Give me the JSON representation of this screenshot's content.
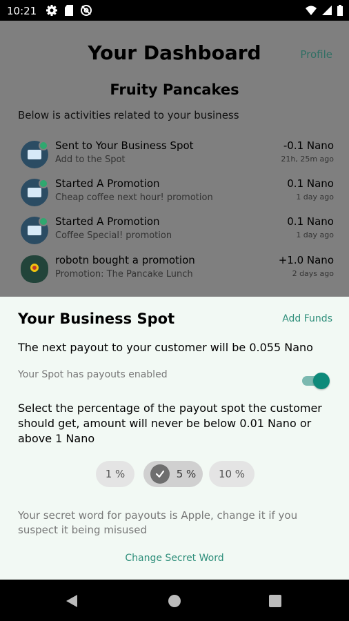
{
  "status_bar": {
    "time": "10:21",
    "icons_left": [
      "gear-icon",
      "sd-card-icon",
      "at-sign-icon"
    ],
    "icons_right": [
      "wifi-icon",
      "signal-icon",
      "battery-icon"
    ]
  },
  "header": {
    "title": "Your Dashboard",
    "profile_link": "Profile",
    "business_name": "Fruity Pancakes",
    "subtitle": "Below is activities related to your business"
  },
  "activities": [
    {
      "title": "Sent to Your Business Spot",
      "description": "Add to the Spot",
      "amount": "-0.1 Nano",
      "time": "21h, 25m ago",
      "avatar": "shop-icon"
    },
    {
      "title": "Started A Promotion",
      "description": "Cheap coffee next hour! promotion",
      "amount": "0.1 Nano",
      "time": "1 day ago",
      "avatar": "shop-icon"
    },
    {
      "title": "Started A Promotion",
      "description": "Coffee Special! promotion",
      "amount": "0.1 Nano",
      "time": "1 day ago",
      "avatar": "shop-icon"
    },
    {
      "title": "robotn bought a promotion",
      "description": "Promotion: The Pancake Lunch",
      "amount": "+1.0 Nano",
      "time": "2 days ago",
      "avatar": "robot-avatar-icon"
    }
  ],
  "business_spot": {
    "title": "Your Business Spot",
    "add_funds": "Add Funds",
    "payout_text": "The next payout to your customer will be 0.055 Nano",
    "payouts_enabled_text": "Your Spot has payouts enabled",
    "payouts_enabled": true,
    "instruction": "Select the percentage of the payout spot the customer should get, amount will never be below 0.01 Nano or above 1 Nano",
    "percent_options": [
      {
        "label": "1 %",
        "selected": false
      },
      {
        "label": "5 %",
        "selected": true
      },
      {
        "label": "10 %",
        "selected": false
      }
    ],
    "secret_text": "Your secret word for payouts is Apple, change it if you suspect it being misused",
    "change_secret": "Change Secret Word"
  },
  "colors": {
    "accent": "#2f8f7b",
    "toggle_on": "#0e8a7a",
    "overlay": "#7f7f7f",
    "sheet_bg": "#f2f9f4"
  }
}
